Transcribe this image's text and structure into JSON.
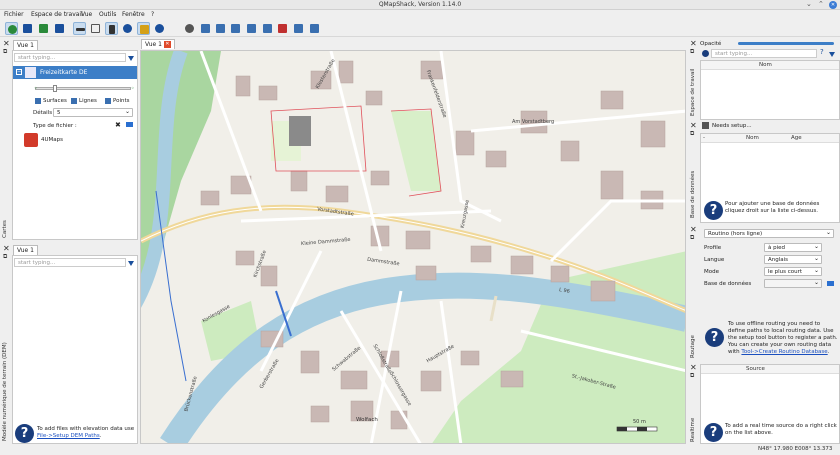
{
  "window": {
    "title": "QMapShack, Version 1.14.0",
    "controls": [
      "⌄",
      "⌃",
      "✕"
    ]
  },
  "menu": [
    "Fichier",
    "Espace de travail",
    "Vue",
    "Outils",
    "Fenêtre",
    "?"
  ],
  "left_top": {
    "tab": "Vue 1",
    "filter_placeholder": "start typing...",
    "map_name": "Freizeitkarte DE",
    "checks": [
      "Surfaces",
      "Lignes",
      "Points"
    ],
    "details_label": "Détails",
    "details_value": "5",
    "filetype_label": "Type de fichier :",
    "map2": "4UMaps",
    "side": "Cartes"
  },
  "left_bottom": {
    "tab": "Vue 1",
    "filter_placeholder": "start typing...",
    "help_text": "To add files with elevation data use",
    "help_link": "File->Setup DEM Paths",
    "help_dot": ".",
    "side": "Modèle numérique de terrain (DEM)"
  },
  "map": {
    "tab": "Vue 1",
    "scale": "50 m",
    "status": "N48° 17.980 E008° 13.373",
    "labels": [
      "Am Vorstadtberg",
      "Kreuzgasse",
      "Vorstadtstraße",
      "Kleine Dammstraße",
      "Dammstraße",
      "Kirchstraße",
      "Hauptstraße",
      "Wolfach",
      "Gerberstraße",
      "Schwabstraße",
      "Schloßstraße",
      "L 96",
      "Klosterstraße",
      "Frankenfelderstraße",
      "St.-Jakober-Straße",
      "Schlossergasse",
      "Konlesgasse",
      "Brückenstraße"
    ]
  },
  "right": {
    "opacity_label": "Opacité",
    "workspace": {
      "filter_placeholder": "start typing...",
      "col": "Nom",
      "side": "Espace de travail"
    },
    "database": {
      "setup": "Needs setup...",
      "cols": [
        "-",
        "Nom",
        "Age"
      ],
      "help": "Pour ajouter une base de données cliquez droit sur la liste ci-dessus.",
      "side": "Base de données"
    },
    "routing": {
      "router": "Routino (hors ligne)",
      "profile_label": "Profile",
      "profile": "à pied",
      "lang_label": "Langue",
      "lang": "Anglais",
      "mode_label": "Mode",
      "mode": "le plus court",
      "db_label": "Base de données",
      "db": "",
      "help": "To use offline routing you need to define paths to local routing data. Use the setup tool button to register a path. You can create your own routing data with ",
      "help_link": "Tool->Create Routino Database",
      "help_end": ".",
      "side": "Routage"
    },
    "realtime": {
      "col": "Source",
      "help": "To add a real time source do a right click on the list above.",
      "side": "Realtime"
    }
  }
}
